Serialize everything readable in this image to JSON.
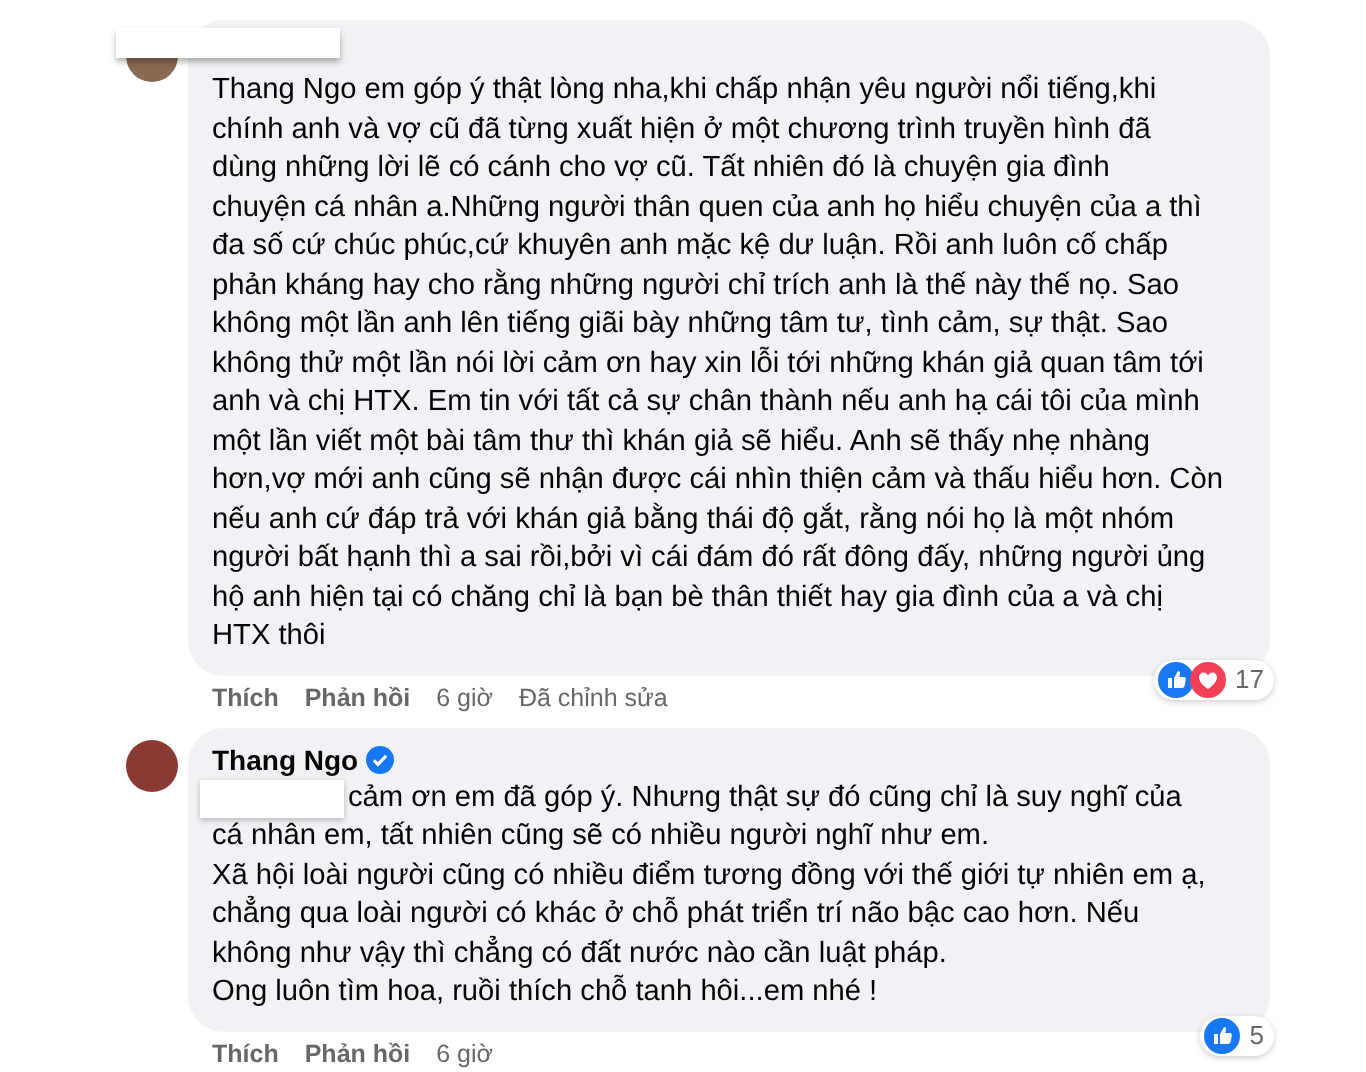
{
  "comments": [
    {
      "redacted_name": true,
      "text": "Thang Ngo em góp ý thật lòng nha,khi chấp nhận yêu người nổi tiếng,khi\nchính anh và vợ cũ đã từng xuất hiện ở một chương trình truyền hình đã\ndùng những lời lẽ có cánh cho vợ cũ. Tất nhiên đó là chuyện gia đình\nchuyện cá nhân a.Những người thân quen của anh họ hiểu chuyện của a thì\nđa số cứ chúc phúc,cứ khuyên anh mặc kệ dư luận. Rồi anh luôn cố chấp\nphản kháng hay cho rằng những người chỉ trích anh là thế này thế nọ. Sao\nkhông một lần anh lên tiếng giãi bày những tâm tư, tình cảm, sự thật. Sao\nkhông thử một lần nói lời cảm ơn hay xin lỗi tới những khán giả quan tâm tới\nanh và chị HTX. Em tin với tất cả sự chân thành nếu anh hạ cái tôi của mình\nmột lần viết một bài tâm thư thì khán giả sẽ hiểu. Anh sẽ thấy nhẹ nhàng\nhơn,vợ mới anh cũng sẽ nhận được cái nhìn thiện cảm và thấu hiểu hơn. Còn\nnếu anh cứ đáp trả với khán giả bằng thái độ gắt, rằng nói họ là một nhóm\nngười bất hạnh thì a sai rồi,bởi vì cái đám đó rất đông đấy, những người ủng\nhộ anh hiện tại có chăng chỉ là bạn bè thân thiết hay gia đình của a và chị\nHTX thôi",
      "actions": [
        "Thích",
        "Phản hồi",
        "6 giờ",
        "Đã chỉnh sửa"
      ],
      "reactions": [
        {
          "kind": "like"
        },
        {
          "kind": "love"
        }
      ],
      "reaction_count": "17"
    },
    {
      "author": "Thang Ngo",
      "verified": true,
      "redacted_prefix": true,
      "text": "cảm ơn em đã góp ý. Nhưng thật sự đó cũng chỉ là suy nghĩ của\ncá nhân em, tất nhiên cũng sẽ có nhiều người nghĩ như em.\nXã hội loài người cũng có nhiều điểm tương đồng với thế giới tự nhiên em ạ,\nchẳng qua loài người có khác ở chỗ phát triển trí não bậc cao hơn. Nếu\nkhông như vậy thì chẳng có đất nước nào cần luật pháp.\nOng luôn tìm hoa, ruồi thích chỗ tanh hôi...em nhé !",
      "actions": [
        "Thích",
        "Phản hồi",
        "6 giờ"
      ],
      "reactions": [
        {
          "kind": "like"
        }
      ],
      "reaction_count": "5"
    }
  ]
}
